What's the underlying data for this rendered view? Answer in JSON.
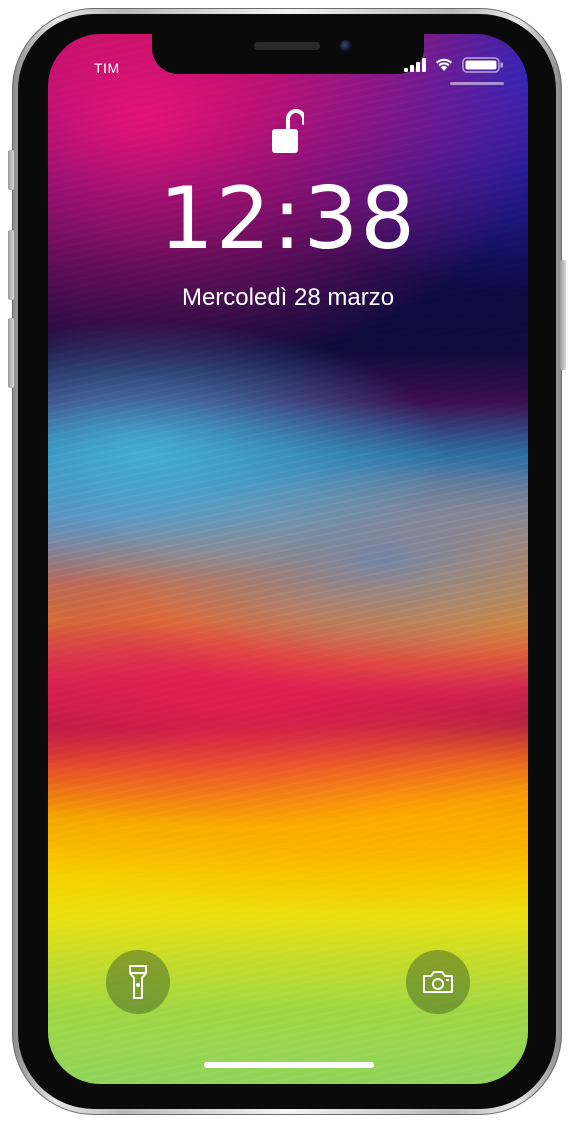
{
  "status_bar": {
    "carrier": "TIM",
    "signal_icon": "cellular-signal-icon",
    "wifi_icon": "wifi-icon",
    "battery_icon": "battery-icon"
  },
  "lock_screen": {
    "lock_icon": "unlocked-padlock-icon",
    "time": "12:38",
    "date": "Mercoledì 28 marzo"
  },
  "quick_actions": {
    "flashlight_icon": "flashlight-icon",
    "camera_icon": "camera-icon"
  },
  "colors": {
    "text": "#ffffff",
    "frame": "#c8c8ca",
    "bezel": "#0a0a0b"
  }
}
